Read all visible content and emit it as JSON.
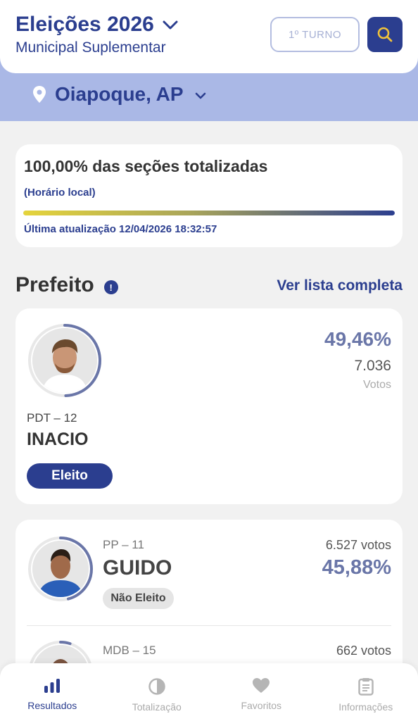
{
  "header": {
    "title": "Eleições 2026",
    "subtitle": "Municipal Suplementar",
    "turno_label": "1º TURNO"
  },
  "location": {
    "name": "Oiapoque, AP"
  },
  "status": {
    "title": "100,00% das seções totalizadas",
    "local_time": "(Horário local)",
    "progress": 1.0,
    "last_update": "Última atualização 12/04/2026 18:32:57"
  },
  "section": {
    "title": "Prefeito",
    "info_icon": "!",
    "see_all": "Ver lista completa"
  },
  "candidates": [
    {
      "party": "PDT – 12",
      "name": "INACIO",
      "percent": "49,46%",
      "votes": "7.036",
      "votes_label": "Votos",
      "status": "Eleito",
      "share": 0.4946
    },
    {
      "party": "PP – 11",
      "name": "GUIDO",
      "percent": "45,88%",
      "votes": "6.527 votos",
      "status": "Não Eleito",
      "share": 0.4588
    },
    {
      "party": "MDB – 15",
      "votes": "662 votos",
      "share": 0.05
    }
  ],
  "nav": {
    "items": [
      {
        "label": "Resultados",
        "icon": "bar-chart-icon",
        "active": true
      },
      {
        "label": "Totalização",
        "icon": "pie-chart-icon",
        "active": false
      },
      {
        "label": "Favoritos",
        "icon": "heart-icon",
        "active": false
      },
      {
        "label": "Informações",
        "icon": "document-icon",
        "active": false
      }
    ]
  },
  "colors": {
    "primary": "#2b3e8f",
    "band": "#aab8e6",
    "accent_yellow": "#e5d43c"
  }
}
